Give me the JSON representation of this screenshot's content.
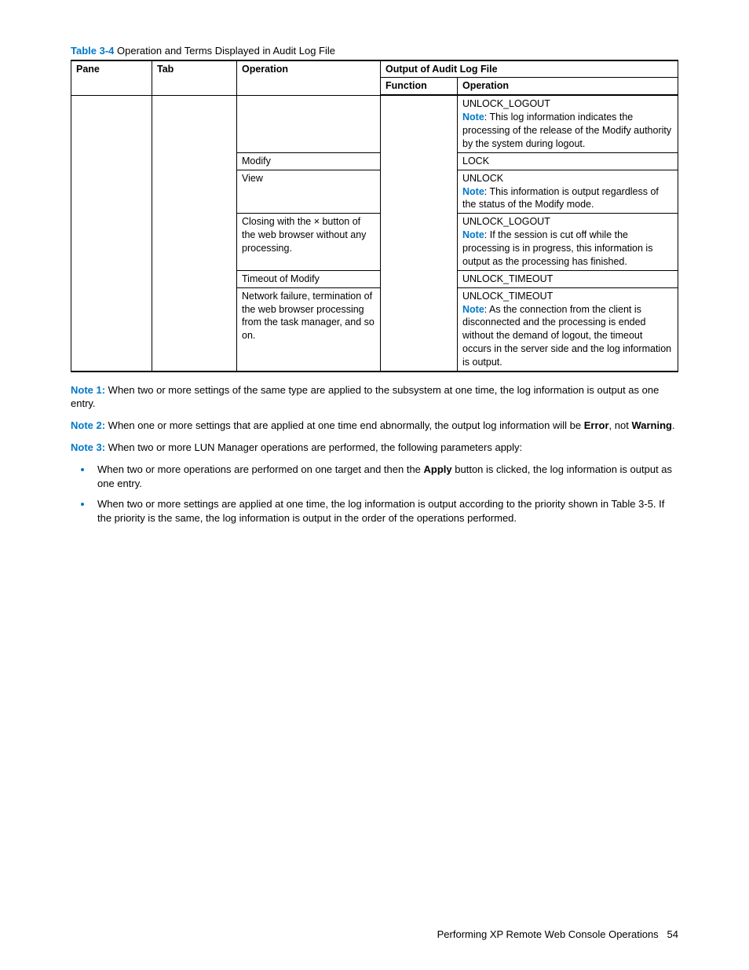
{
  "caption": {
    "label": "Table 3-4",
    "text": "Operation and Terms Displayed in Audit Log File"
  },
  "headers": {
    "pane": "Pane",
    "tab": "Tab",
    "operation": "Operation",
    "output": "Output of Audit Log File",
    "function": "Function",
    "op_out": "Operation"
  },
  "rows": {
    "r1": {
      "op": "",
      "out_code": "UNLOCK_LOGOUT",
      "note_label": "Note",
      "note_colon": ":",
      "note_text": " This log information indicates the processing of the release of the Modify authority by the system during logout."
    },
    "r2": {
      "op": "Modify",
      "out_code": "LOCK"
    },
    "r3": {
      "op": "View",
      "out_code": "UNLOCK",
      "note_label": "Note",
      "note_colon": ":",
      "note_text": " This information is output regardless of the status of the Modify mode."
    },
    "r4": {
      "op": "Closing with the × button of the web browser without any processing.",
      "out_code": "UNLOCK_LOGOUT",
      "note_label": "Note",
      "note_colon": ":",
      "note_text": " If the session is cut off while the processing is in progress, this information is output as the processing has finished."
    },
    "r5": {
      "op": "Timeout of Modify",
      "out_code": "UNLOCK_TIMEOUT"
    },
    "r6": {
      "op": "Network failure, termination of the web browser processing from the task manager, and so on.",
      "out_code": "UNLOCK_TIMEOUT",
      "note_label": "Note",
      "note_colon": ":",
      "note_text": " As the connection from the client is disconnected and the processing is ended without the demand of logout, the timeout occurs in the server side and the log information is output."
    }
  },
  "notes": {
    "n1_label": "Note 1:",
    "n1_text": " When two or more settings of the same type are applied to the subsystem at one time, the log information is output as one entry.",
    "n2_label": "Note 2:",
    "n2_text_a": " When one or more settings that are applied at one time end abnormally, the output log information will be ",
    "n2_error": "Error",
    "n2_not": ", not ",
    "n2_warning": "Warning",
    "n2_period": ".",
    "n3_label": "Note 3:",
    "n3_text": " When two or more LUN Manager operations are performed, the following parameters apply:",
    "bullet1_a": "When two or more operations are performed on one target and then the ",
    "bullet1_apply": "Apply",
    "bullet1_b": " button is clicked, the log information is output as one entry.",
    "bullet2": "When two or more settings are applied at one time, the log information is output according to the priority shown in Table 3-5. If the priority is the same, the log information is output in the order of the operations performed."
  },
  "footer": {
    "text": "Performing XP Remote Web Console Operations",
    "page": "54"
  }
}
